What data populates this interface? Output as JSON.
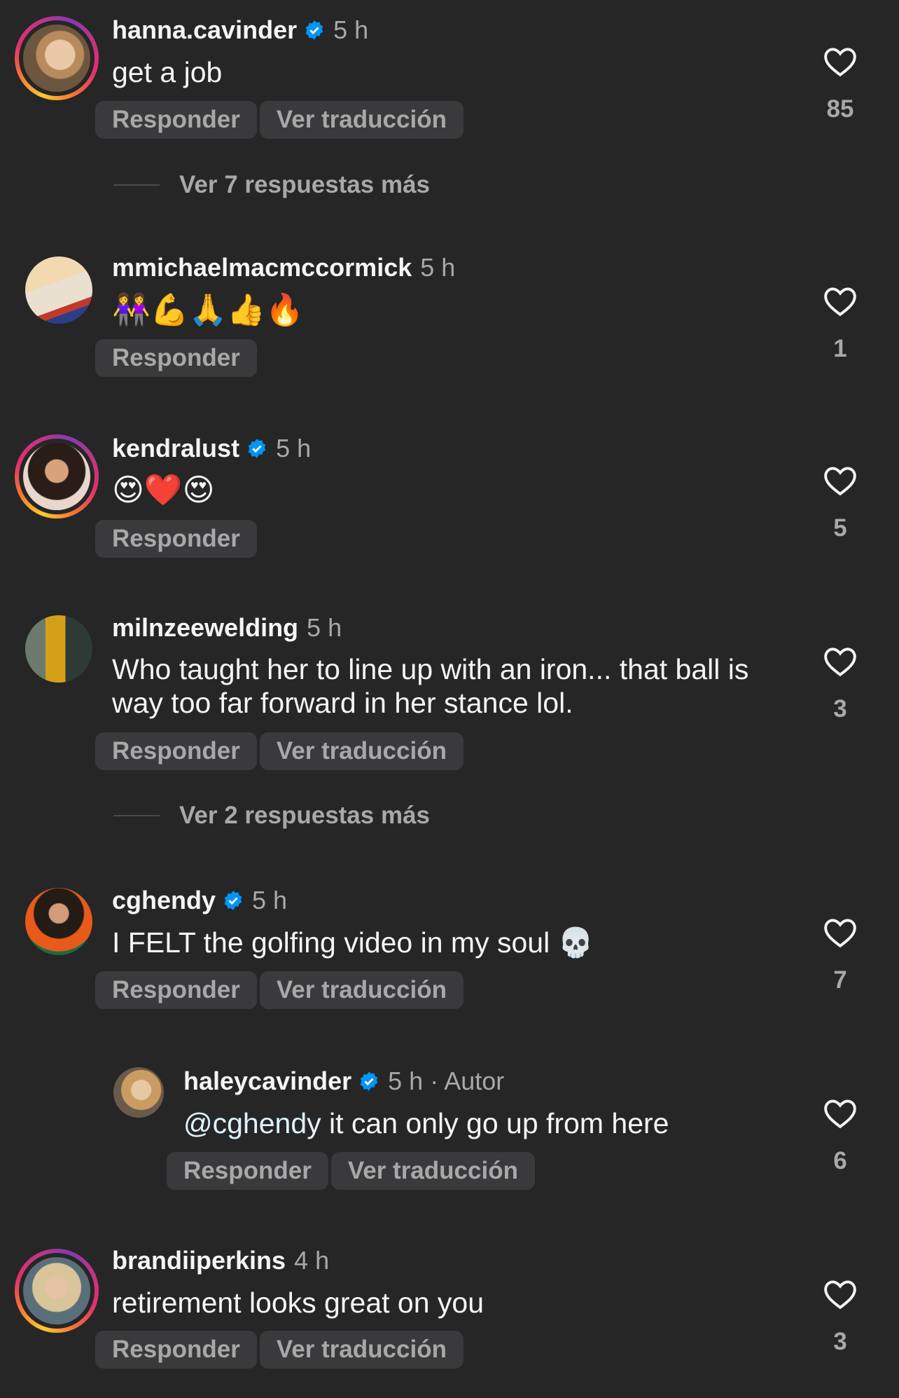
{
  "colors": {
    "background": "#262626",
    "verified": "#0095f6",
    "secondary": "#a8a8a8",
    "button_bg": "#3a3a3c"
  },
  "labels": {
    "reply": "Responder",
    "translate": "Ver traducción"
  },
  "comments": [
    {
      "username": "hanna.cavinder",
      "verified": true,
      "time": "5 h",
      "text": "get a job",
      "likes": "85",
      "replies": "Ver 7 respuestas más"
    },
    {
      "username": "mmichaelmacmccormick",
      "verified": false,
      "time": "5 h",
      "text": "👭💪🙏👍🔥",
      "likes": "1"
    },
    {
      "username": "kendralust",
      "verified": true,
      "time": "5 h",
      "text": "😍❤️😍",
      "likes": "5"
    },
    {
      "username": "milnzeewelding",
      "verified": false,
      "time": "5 h",
      "text": "Who taught her to line up with an iron... that ball is way too far forward in her stance lol.",
      "likes": "3",
      "replies": "Ver 2 respuestas más"
    },
    {
      "username": "cghendy",
      "verified": true,
      "time": "5 h",
      "text": "I FELT the golfing video in my soul 💀",
      "likes": "7"
    },
    {
      "username": "haleycavinder",
      "verified": true,
      "time": "5 h · Autor",
      "mention": "@cghendy",
      "text": " it can only go up from here",
      "likes": "6"
    },
    {
      "username": "brandiiperkins",
      "verified": false,
      "time": "4 h",
      "text": "retirement looks great on you",
      "likes": "3"
    }
  ]
}
